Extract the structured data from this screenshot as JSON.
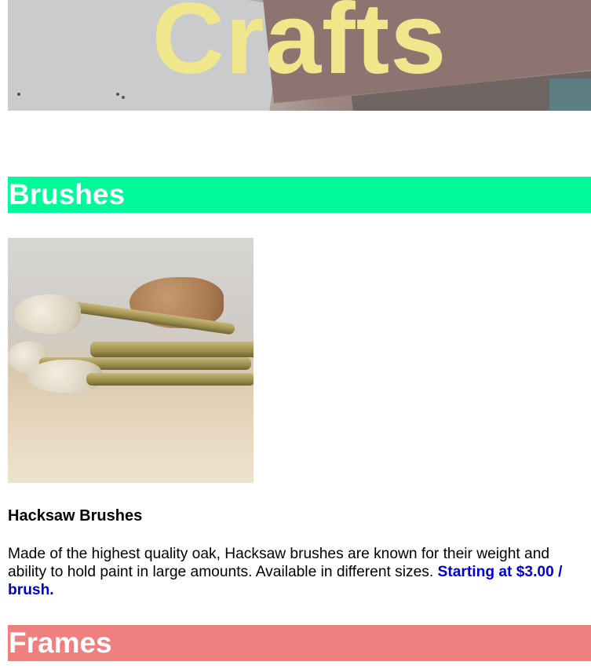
{
  "header": {
    "title": "Crafts"
  },
  "sections": [
    {
      "heading": "Brushes",
      "product": {
        "image_alt": "Hacksaw brushes on a table",
        "name": "Hacksaw Brushes",
        "description": "Made of the highest quality oak, Hacksaw brushes are known for their weight and ability to hold paint in large amounts. Available in different sizes.",
        "price_text": "Starting at $3.00 / brush."
      }
    },
    {
      "heading": "Frames"
    }
  ],
  "colors": {
    "title_text": "#f0e68c",
    "brushes_heading_bg": "#00fa9a",
    "frames_heading_bg": "#f08080",
    "price_text": "#0000cd"
  }
}
